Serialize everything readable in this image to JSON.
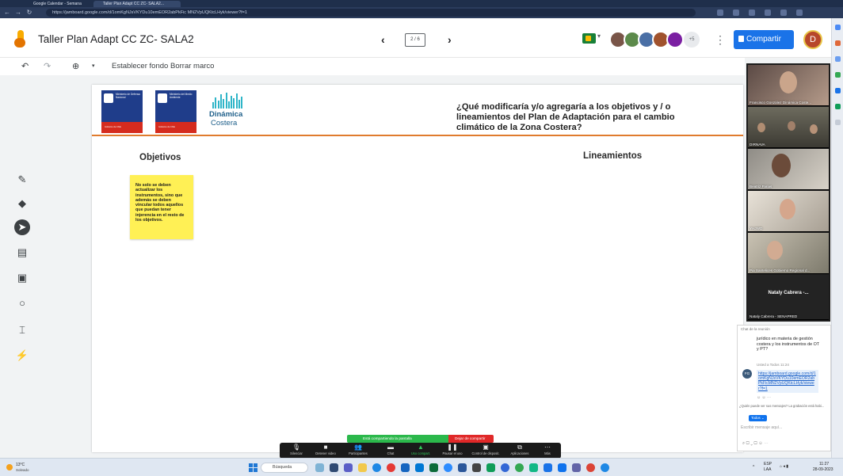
{
  "browser": {
    "tabs": [
      "Google Calendar - Semana del ...",
      "Taller Plan Adapt CC ZC- SALA2..."
    ],
    "url": "https://jamboard.google.com/d/1omKgNJsVKYDu10emEOR2abPkFic MN2VpUQKtcLHyk/viewer?f=1"
  },
  "jam": {
    "title": "Taller Plan Adapt CC ZC- SALA2",
    "frame_counter": "2 / 6",
    "more_participants": "+5",
    "share_label": "Compartir",
    "avatar_initial": "D"
  },
  "toolbar": {
    "set_background": "Establecer fondo",
    "clear_frame": "Borrar marco"
  },
  "frame": {
    "logo1_lines": "Ministerio de Defensa Nacional",
    "logo1_footer": "Gobierno de Chile",
    "logo2_lines": "Ministerio del Medio Ambiente",
    "logo2_footer": "Gobierno de Chile",
    "dc_line1": "Dinámica",
    "dc_line2": "Costera",
    "question": "¿Qué modificaría y/o agregaría a los objetivos y / o lineamientos del Plan de Adaptación para el cambio climático de la Zona Costera?",
    "col_left": "Objetivos",
    "col_right": "Lineamientos",
    "sticky_text": "No solo se deben actualizar los instrumentos, sino que además se deben vincular todos aquellos que puedan tener injerencia en el resto de los objetivos."
  },
  "video": {
    "tiles": [
      {
        "name": "Francisco González Dinámica Coste..."
      },
      {
        "name": "DIRNAVA"
      },
      {
        "name": "Beatriz Farias"
      },
      {
        "name": "YHJWD"
      },
      {
        "name": "Pia Santelices Gobierno Regional d..."
      },
      {
        "name": "Nataly Cabrera - SENAPRED",
        "big": "Nataly Cabrera -..."
      }
    ]
  },
  "chat": {
    "header": "Chat de la reunión",
    "message_tail": "jurídico en materia de gestión costera y los instrumentos de OT y PT?",
    "to_label": "Usted a Todos 11:24",
    "sender_initials": "FG",
    "link": "https://jamboard.google.com/d/1omKgNJsVKYDu10emEOR2abPkFicMN2VpUQKtcLHyk/viewer?f=1",
    "notice": "¿Quién puede ver sus mensajes? La grabación está habi...",
    "to_button": "Todos ⌄",
    "input_placeholder": "Escribir mensaje aquí..."
  },
  "zoom": {
    "sharing_status": "Está compartiendo la pantalla",
    "stop_share": "Dejar de compartir",
    "buttons": [
      {
        "icon": "mic-icon",
        "label": "Silenciar"
      },
      {
        "icon": "video-icon",
        "label": "Detener video"
      },
      {
        "icon": "participants-icon",
        "label": "Participantes",
        "count": "18"
      },
      {
        "icon": "chat-icon",
        "label": "Chat"
      },
      {
        "icon": "share-screen-icon",
        "label": "Uso compart."
      },
      {
        "icon": "pause-icon",
        "label": "Pausar el uso"
      },
      {
        "icon": "remote-control-icon",
        "label": "Control de disposit."
      },
      {
        "icon": "apps-icon",
        "label": "Aplicaciones"
      },
      {
        "icon": "more-icon",
        "label": "Más"
      }
    ]
  },
  "taskbar": {
    "temperature": "13°C",
    "weather": "Soleado",
    "search_placeholder": "Búsqueda",
    "lang": "ESP",
    "lang2": "LAA",
    "time": "11:27",
    "date": "28-09-2023"
  },
  "colors": {
    "accent": "#1a73e8",
    "divider_orange": "#e07b2e",
    "sticky_yellow": "#fff055",
    "zoom_green": "#2bb84b",
    "zoom_red": "#e02828"
  }
}
